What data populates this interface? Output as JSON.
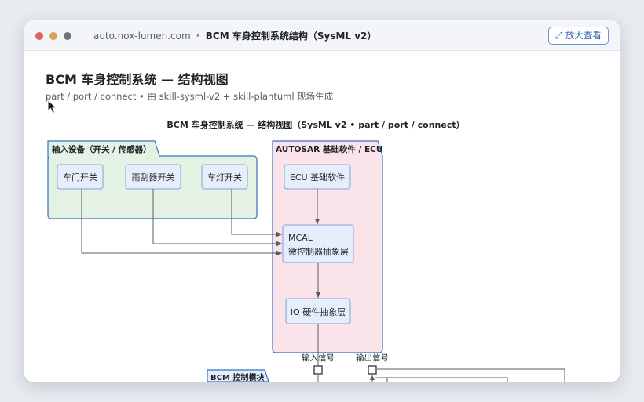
{
  "browser": {
    "host": "auto.nox-lumen.com",
    "separator": "•",
    "page_title": "BCM 车身控制系统结构（SysML v2）",
    "zoom_button": "⤢ 放大查看"
  },
  "page": {
    "title": "BCM 车身控制系统 — 结构视图",
    "subtitle": "part / port / connect  •  由 skill-sysml-v2 + skill-plantuml 现场生成"
  },
  "diagram": {
    "title": "BCM 车身控制系统 — 结构视图（SysML v2  •  part / port / connect）",
    "input_group": {
      "label": "输入设备（开关 / 传感器）",
      "parts": [
        "车门开关",
        "雨刮器开关",
        "车灯开关"
      ]
    },
    "autosar_group": {
      "label": "AUTOSAR 基础软件 / ECU",
      "ecu": "ECU 基础软件",
      "mcal_line1": "MCAL",
      "mcal_line2": "微控制器抽象层",
      "io": "IO 硬件抽象层"
    },
    "ports": {
      "input": "输入信号",
      "output": "输出信号"
    },
    "bcm_group": {
      "label": "BCM 控制模块"
    }
  },
  "colors": {
    "input_fill": "#e3f2e3",
    "autosar_fill": "#fbe3ea",
    "part_fill": "#e6eefb",
    "border": "#3a6fc2",
    "line": "#555b66"
  }
}
